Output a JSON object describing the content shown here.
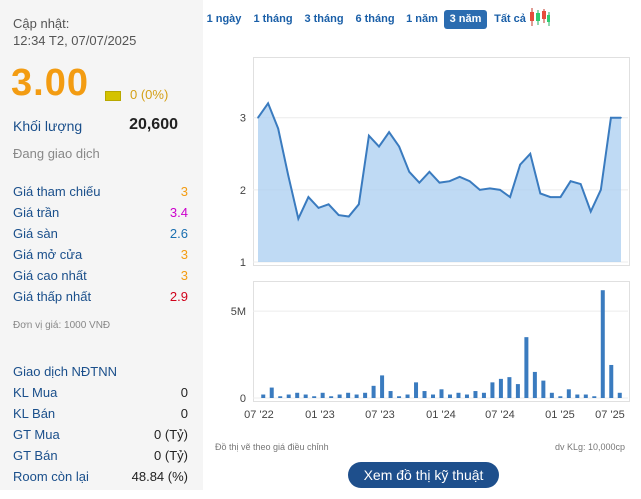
{
  "header": {
    "updated_label": "Cập nhật:",
    "updated_time": "12:34 T2, 07/07/2025",
    "price": "3.00",
    "change": "0 (0%)",
    "volume_label": "Khối lượng",
    "volume": "20,600",
    "status": "Đang giao dịch"
  },
  "prices": [
    {
      "label": "Giá tham chiếu",
      "value": "3",
      "color": "#f39c12"
    },
    {
      "label": "Giá trần",
      "value": "3.4",
      "color": "#cc00cc"
    },
    {
      "label": "Giá sàn",
      "value": "2.6",
      "color": "#1a6fb0"
    },
    {
      "label": "Giá mở cửa",
      "value": "3",
      "color": "#f39c12"
    },
    {
      "label": "Giá cao nhất",
      "value": "3",
      "color": "#f39c12"
    },
    {
      "label": "Giá thấp nhất",
      "value": "2.9",
      "color": "#d0021b"
    }
  ],
  "unit_note": "Đơn vị giá: 1000 VNĐ",
  "foreign": {
    "title": "Giao dịch NĐTNN",
    "rows": [
      {
        "label": "KL Mua",
        "value": "0"
      },
      {
        "label": "KL Bán",
        "value": "0"
      },
      {
        "label": "GT Mua",
        "value": "0 (Tỷ)"
      },
      {
        "label": "GT Bán",
        "value": "0 (Tỷ)"
      },
      {
        "label": "Room còn lại",
        "value": "48.84 (%)"
      }
    ]
  },
  "tabs": [
    {
      "label": "1 ngày",
      "active": false
    },
    {
      "label": "1 tháng",
      "active": false
    },
    {
      "label": "3 tháng",
      "active": false
    },
    {
      "label": "6 tháng",
      "active": false
    },
    {
      "label": "1 năm",
      "active": false
    },
    {
      "label": "3 năm",
      "active": true
    },
    {
      "label": "Tất cả",
      "active": false
    }
  ],
  "candle_icon": "candlestick-icon",
  "footer": {
    "note": "Đồ thị vẽ theo giá điều chỉnh",
    "volume_unit": "dv KLg: 10,000cp",
    "button": "Xem đồ thị kỹ thuật"
  },
  "colors": {
    "accent": "#2b6cb0",
    "price_line": "#3a7bbf",
    "area_fill": "#a9cdf0",
    "volume_bar": "#3a7bbf",
    "price_up": "#f39c12"
  },
  "chart_data": [
    {
      "type": "area",
      "y_ticks": [
        "1",
        "2",
        "3"
      ],
      "ylim": [
        1,
        3.8
      ],
      "x": [
        0,
        1,
        2,
        3,
        4,
        5,
        6,
        7,
        8,
        9,
        10,
        11,
        12,
        13,
        14,
        15,
        16,
        17,
        18,
        19,
        20,
        21,
        22,
        23,
        24,
        25,
        26,
        27,
        28,
        29,
        30,
        31,
        32,
        33,
        34,
        35,
        36
      ],
      "values": [
        3.0,
        3.2,
        2.85,
        2.2,
        1.6,
        1.9,
        1.75,
        1.8,
        1.65,
        1.63,
        1.8,
        2.75,
        2.6,
        2.8,
        2.6,
        2.25,
        2.1,
        2.25,
        2.1,
        2.12,
        2.18,
        2.12,
        2.0,
        2.02,
        2.0,
        1.9,
        2.35,
        2.5,
        1.95,
        1.9,
        1.9,
        2.12,
        2.08,
        1.7,
        2.0,
        3.0,
        3.0
      ]
    },
    {
      "type": "bar",
      "y_ticks": [
        "0",
        "5M"
      ],
      "ylim": [
        0,
        6.5
      ],
      "x_labels": [
        "07 '22",
        "01 '23",
        "07 '23",
        "01 '24",
        "07 '24",
        "01 '25",
        "07 '25"
      ],
      "values": [
        0.2,
        0.6,
        0.1,
        0.2,
        0.3,
        0.2,
        0.1,
        0.3,
        0.1,
        0.2,
        0.3,
        0.2,
        0.3,
        0.7,
        1.3,
        0.4,
        0.1,
        0.2,
        0.9,
        0.4,
        0.2,
        0.5,
        0.2,
        0.3,
        0.2,
        0.4,
        0.3,
        0.9,
        1.1,
        1.2,
        0.8,
        3.5,
        1.5,
        1.0,
        0.3,
        0.1,
        0.5,
        0.2,
        0.2,
        0.1,
        6.2,
        1.9,
        0.3
      ]
    }
  ]
}
